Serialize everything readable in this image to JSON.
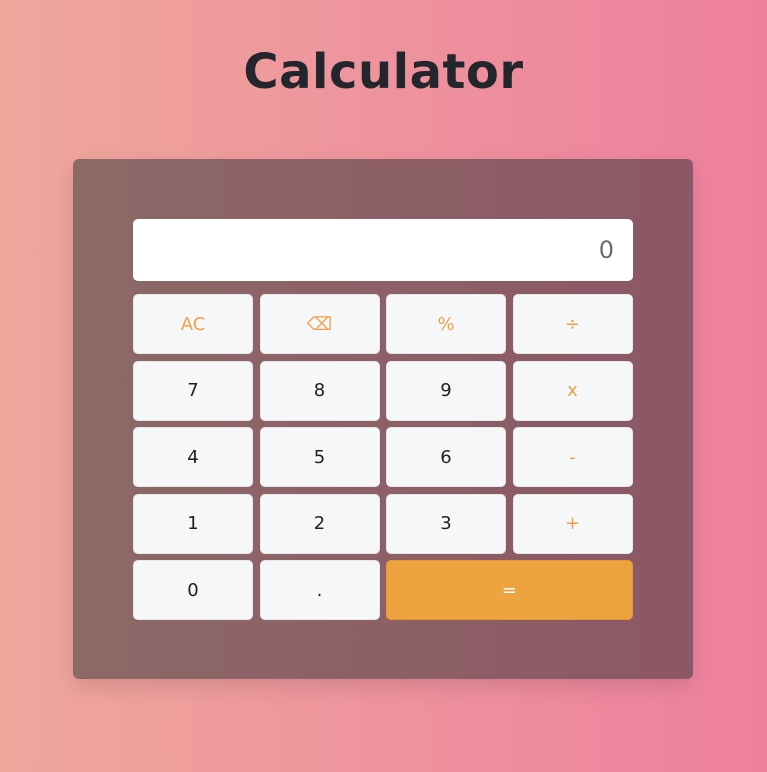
{
  "title": "Calculator",
  "display": {
    "value": "0"
  },
  "keys": {
    "clear": "AC",
    "backspace": "⌫",
    "percent": "%",
    "divide": "÷",
    "seven": "7",
    "eight": "8",
    "nine": "9",
    "multiply": "x",
    "four": "4",
    "five": "5",
    "six": "6",
    "subtract": "-",
    "one": "1",
    "two": "2",
    "three": "3",
    "add": "+",
    "zero": "0",
    "decimal": ".",
    "equals": "="
  },
  "colors": {
    "operator": "#f0a04b",
    "equals_bg": "#eda33f",
    "panel": "#8c5f66"
  }
}
